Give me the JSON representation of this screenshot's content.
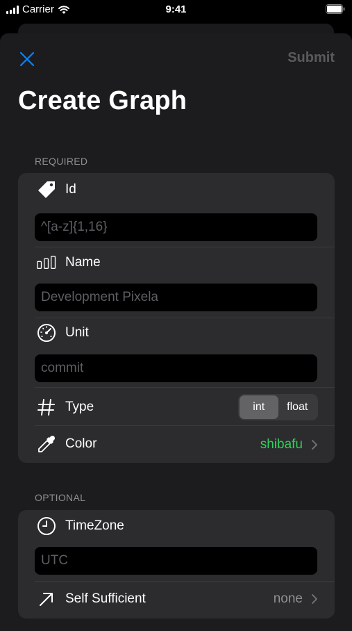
{
  "status_bar": {
    "carrier": "Carrier",
    "time": "9:41"
  },
  "header": {
    "submit_label": "Submit",
    "title": "Create Graph"
  },
  "required": {
    "section_label": "REQUIRED",
    "id": {
      "label": "Id",
      "placeholder": "^[a-z]{1,16}"
    },
    "name": {
      "label": "Name",
      "placeholder": "Development Pixela"
    },
    "unit": {
      "label": "Unit",
      "placeholder": "commit"
    },
    "type": {
      "label": "Type",
      "options": [
        "int",
        "float"
      ],
      "selected": "int"
    },
    "color": {
      "label": "Color",
      "value": "shibafu",
      "value_color": "#30d158"
    }
  },
  "optional": {
    "section_label": "OPTIONAL",
    "timezone": {
      "label": "TimeZone",
      "placeholder": "UTC"
    },
    "self_sufficient": {
      "label": "Self Sufficient",
      "value": "none"
    }
  },
  "colors": {
    "accent": "#0a84ff",
    "sheet": "#1c1c1e",
    "group": "#2c2c2e"
  }
}
